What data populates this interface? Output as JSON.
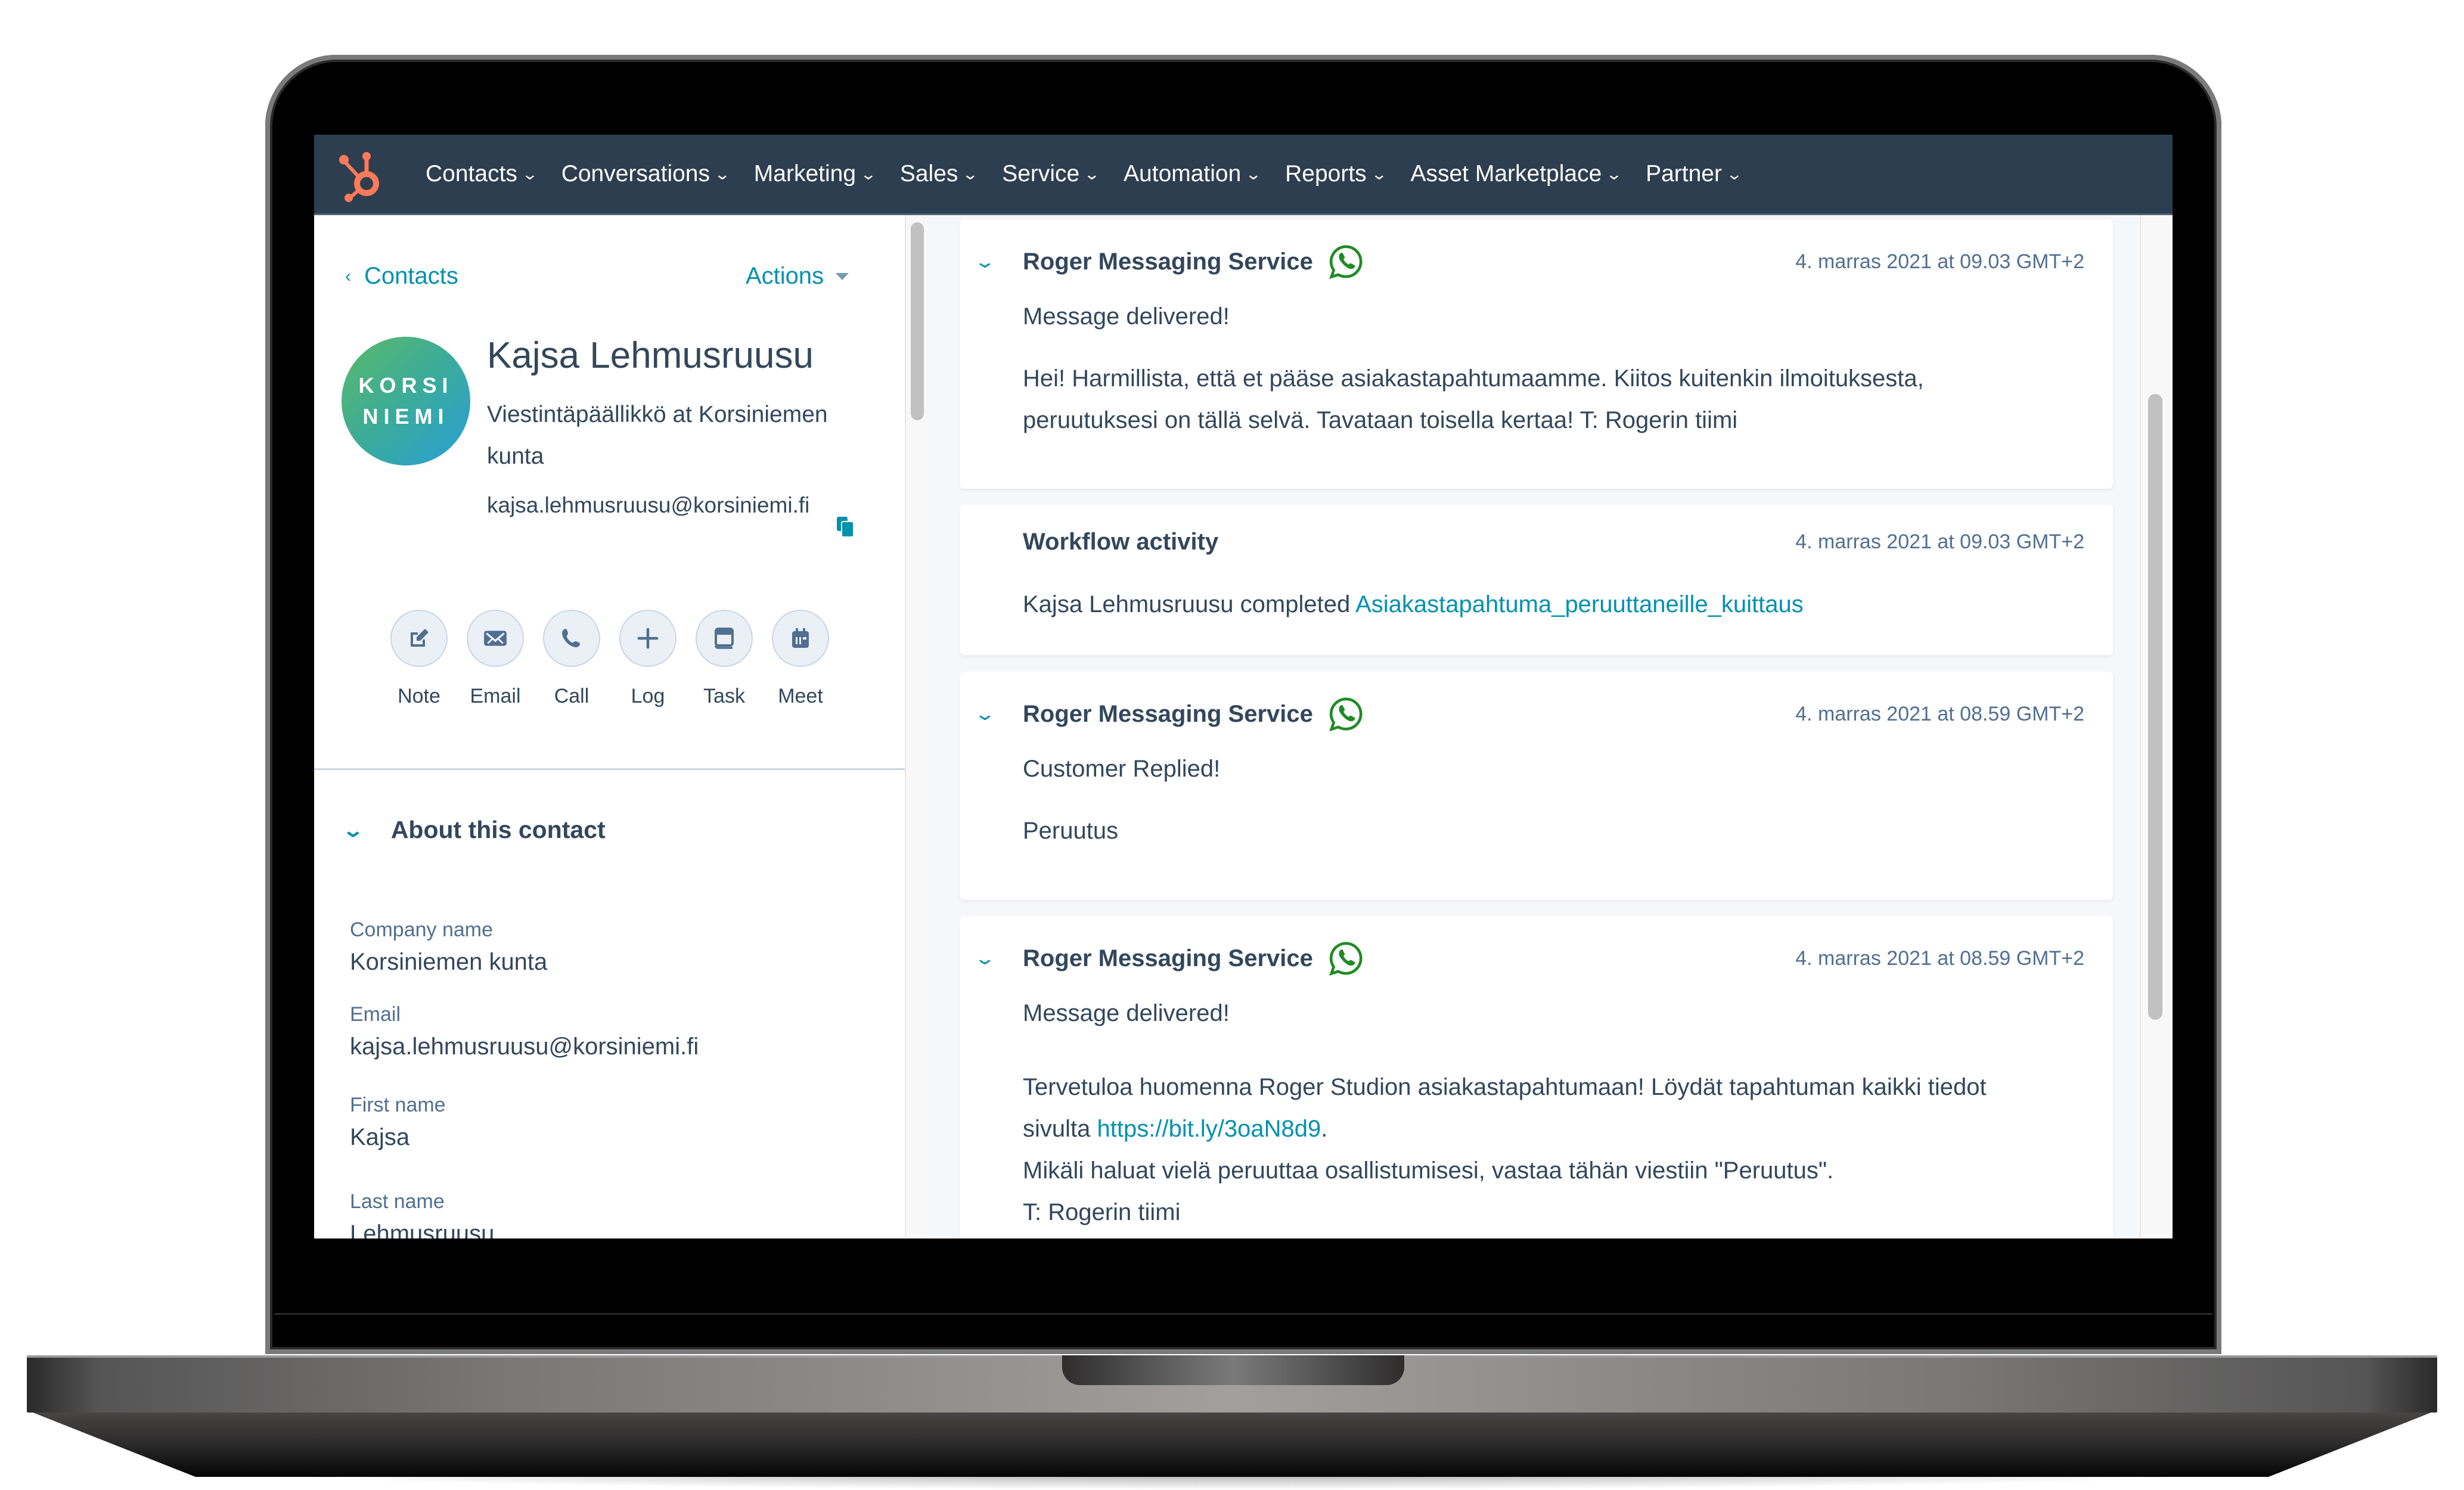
{
  "nav": {
    "logo": "hubspot-sprocket-icon",
    "items": [
      {
        "label": "Contacts"
      },
      {
        "label": "Conversations"
      },
      {
        "label": "Marketing"
      },
      {
        "label": "Sales"
      },
      {
        "label": "Service"
      },
      {
        "label": "Automation"
      },
      {
        "label": "Reports"
      },
      {
        "label": "Asset Marketplace"
      },
      {
        "label": "Partner"
      }
    ],
    "chevron": "⌄"
  },
  "sidebar": {
    "back_label": "Contacts",
    "back_arrow": "‹",
    "actions_label": "Actions",
    "avatar_line1": "KORSI",
    "avatar_line2": "NIEMI",
    "name": "Kajsa Lehmusruusu",
    "title": "Viestintäpäällikkö at Korsiniemen kunta",
    "email": "kajsa.lehmusruusu@korsiniemi.fi",
    "actions": [
      {
        "label": "Note",
        "icon": "note-edit-icon"
      },
      {
        "label": "Email",
        "icon": "email-icon"
      },
      {
        "label": "Call",
        "icon": "phone-icon"
      },
      {
        "label": "Log",
        "icon": "plus-icon"
      },
      {
        "label": "Task",
        "icon": "task-icon"
      },
      {
        "label": "Meet",
        "icon": "calendar-icon"
      }
    ],
    "about_label": "About this contact",
    "properties": [
      {
        "label": "Company name",
        "value": "Korsiniemen kunta"
      },
      {
        "label": "Email",
        "value": "kajsa.lehmusruusu@korsiniemi.fi"
      },
      {
        "label": "First name",
        "value": "Kajsa"
      },
      {
        "label": "Last name",
        "value": "Lehmusruusu"
      }
    ]
  },
  "timeline": {
    "cards": [
      {
        "title": "Roger Messaging Service",
        "timestamp": "4. marras 2021 at 09.03 GMT+2",
        "status": "Message delivered!",
        "message": "Hei! Harmillista, että et pääse asiakastapahtumaamme. Kiitos kuitenkin ilmoituksesta, peruutuksesi on tällä selvä. Tavataan toisella kertaa! T: Rogerin tiimi"
      },
      {
        "title": "Workflow activity",
        "timestamp": "4. marras 2021 at 09.03 GMT+2",
        "text": "Kajsa Lehmusruusu completed",
        "link": "Asiakastapahtuma_peruuttaneille_kuittaus"
      },
      {
        "title": "Roger Messaging Service",
        "timestamp": "4. marras 2021 at 08.59 GMT+2",
        "status": "Customer Replied!",
        "message": "Peruutus"
      },
      {
        "title": "Roger Messaging Service",
        "timestamp": "4. marras 2021 at 08.59 GMT+2",
        "status": "Message delivered!",
        "line1": "Tervetuloa huomenna Roger Studion asiakastapahtumaan! Löydät tapahtuman kaikki tiedot",
        "line2_prefix": "sivulta",
        "line2_link": "https://bit.ly/3oaN8d9",
        "line2_suffix": ".",
        "line3": "Mikäli haluat vielä peruuttaa osallistumisesi, vastaa tähän viestiin \"Peruutus\".",
        "line4": "T: Rogerin tiimi"
      }
    ]
  },
  "colors": {
    "nav_bg": "#2d3e50",
    "accent": "#0091ae",
    "hubspot_orange": "#ff7a59",
    "whatsapp_green": "#1f8b24",
    "text": "#33475b"
  }
}
